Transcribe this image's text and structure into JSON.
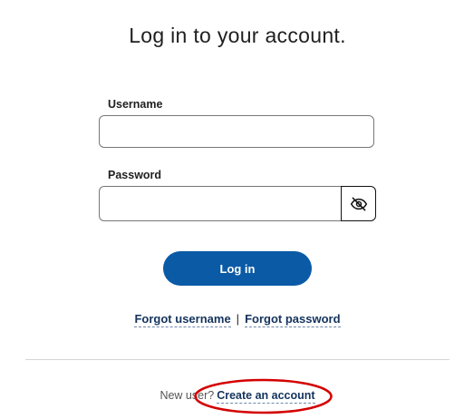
{
  "page": {
    "title": "Log in to your account."
  },
  "form": {
    "username_label": "Username",
    "username_value": "",
    "password_label": "Password",
    "password_value": "",
    "toggle_password_icon": "eye-slash-icon",
    "login_button_label": "Log in"
  },
  "links": {
    "forgot_username": "Forgot username",
    "separator": "|",
    "forgot_password": "Forgot password"
  },
  "signup": {
    "prompt": "New user?",
    "create_account": "Create an account"
  },
  "annotation": {
    "highlight_color": "#d40000"
  },
  "colors": {
    "primary_button": "#0a5aa6",
    "link_text": "#14335c"
  }
}
